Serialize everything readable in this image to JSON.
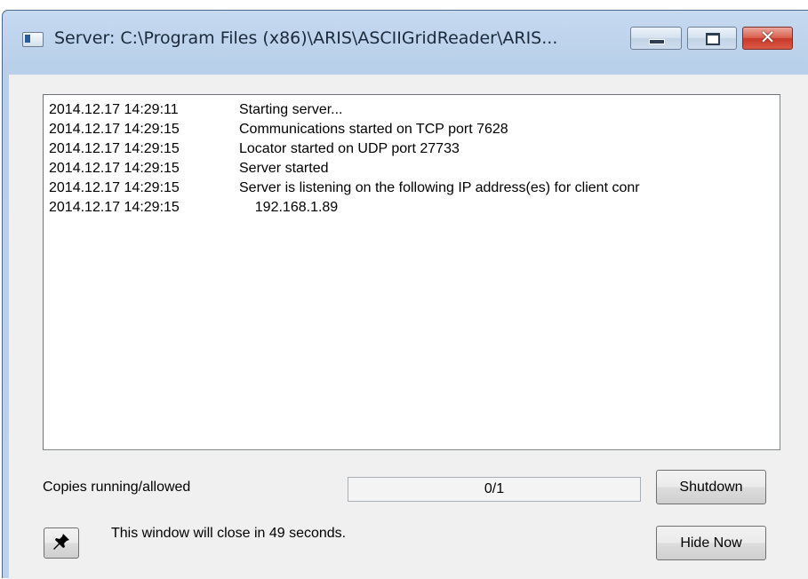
{
  "window": {
    "title": "Server: C:\\Program Files (x86)\\ARIS\\ASCIIGridReader\\ARIS...",
    "icon": "application-window-icon",
    "controls": {
      "minimize": "minimize-icon",
      "maximize": "maximize-icon",
      "close": "✕"
    }
  },
  "log": {
    "lines": [
      {
        "timestamp": "2014.12.17 14:29:11",
        "message": "Starting server..."
      },
      {
        "timestamp": "2014.12.17 14:29:15",
        "message": "Communications started on TCP port 7628"
      },
      {
        "timestamp": "2014.12.17 14:29:15",
        "message": "Locator started on UDP port 27733"
      },
      {
        "timestamp": "2014.12.17 14:29:15",
        "message": "Server started"
      },
      {
        "timestamp": "2014.12.17 14:29:15",
        "message": "Server is listening on the following IP address(es) for client conr"
      },
      {
        "timestamp": "2014.12.17 14:29:15",
        "message": "    192.168.1.89"
      }
    ]
  },
  "status": {
    "copies_label": "Copies running/allowed",
    "copies_value": "0/1",
    "close_message": "This window will close in 49 seconds."
  },
  "buttons": {
    "shutdown": "Shutdown",
    "hide_now": "Hide Now",
    "pin_icon": "pin-icon"
  },
  "colors": {
    "close_button": "#c8392a",
    "titlebar": "#c6daf0"
  }
}
